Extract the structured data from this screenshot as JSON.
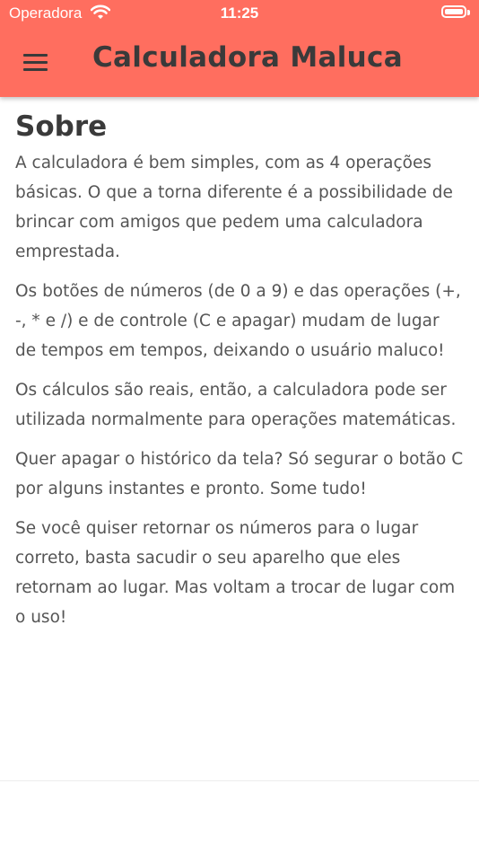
{
  "status_bar": {
    "carrier": "Operadora",
    "time": "11:25"
  },
  "header": {
    "title": "Calculadora Maluca",
    "menu_icon": "hamburger-menu-icon"
  },
  "colors": {
    "appbar": "#ff6e5f",
    "title": "#3a3a3a",
    "body_text": "#555555"
  },
  "about": {
    "heading": "Sobre",
    "paragraphs": [
      "A calculadora é bem simples, com as 4 operações básicas. O que a torna diferente é a possibilidade de brincar com amigos que pedem uma calculadora emprestada.",
      "Os botões de números (de 0 a 9) e das operações (+, -, * e /) e de controle (C e apagar) mudam de lugar de tempos em tempos, deixando o usuário maluco!",
      "Os cálculos são reais, então, a calculadora pode ser utilizada normalmente para operações matemáticas.",
      "Quer apagar o histórico da tela? Só segurar o botão C por alguns instantes e pronto. Some tudo!",
      "Se você quiser retornar os números para o lugar correto, basta sacudir o seu aparelho que eles retornam ao lugar. Mas voltam a trocar de lugar com o uso!"
    ]
  }
}
